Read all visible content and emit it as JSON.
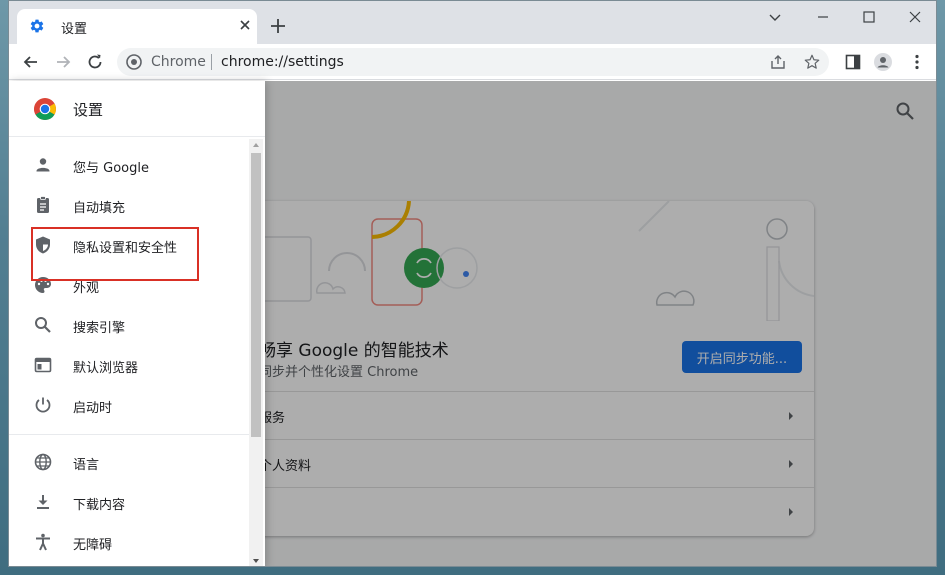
{
  "tab": {
    "title": "设置",
    "favicon": "gear-icon",
    "accent": "#1a73e8"
  },
  "omnibox": {
    "site_label": "Chrome",
    "url": "chrome://settings"
  },
  "drawer": {
    "title": "设置",
    "items": [
      {
        "label": "您与 Google",
        "icon": "person-icon"
      },
      {
        "label": "自动填充",
        "icon": "clipboard-icon"
      },
      {
        "label": "隐私设置和安全性",
        "icon": "shield-icon"
      },
      {
        "label": "外观",
        "icon": "palette-icon"
      },
      {
        "label": "搜索引擎",
        "icon": "search-icon"
      },
      {
        "label": "默认浏览器",
        "icon": "browser-icon"
      },
      {
        "label": "启动时",
        "icon": "power-icon"
      },
      {
        "label": "语言",
        "icon": "globe-icon"
      },
      {
        "label": "下载内容",
        "icon": "download-icon"
      },
      {
        "label": "无障碍",
        "icon": "accessibility-icon"
      }
    ]
  },
  "background_card": {
    "title": "畅享 Google 的智能技术",
    "subtitle": "同步并个性化设置 Chrome",
    "sync_button": "开启同步功能...",
    "rows": [
      "服务",
      "个人资料",
      ""
    ]
  },
  "colors": {
    "highlight": "#d93025",
    "primary": "#1a73e8"
  }
}
